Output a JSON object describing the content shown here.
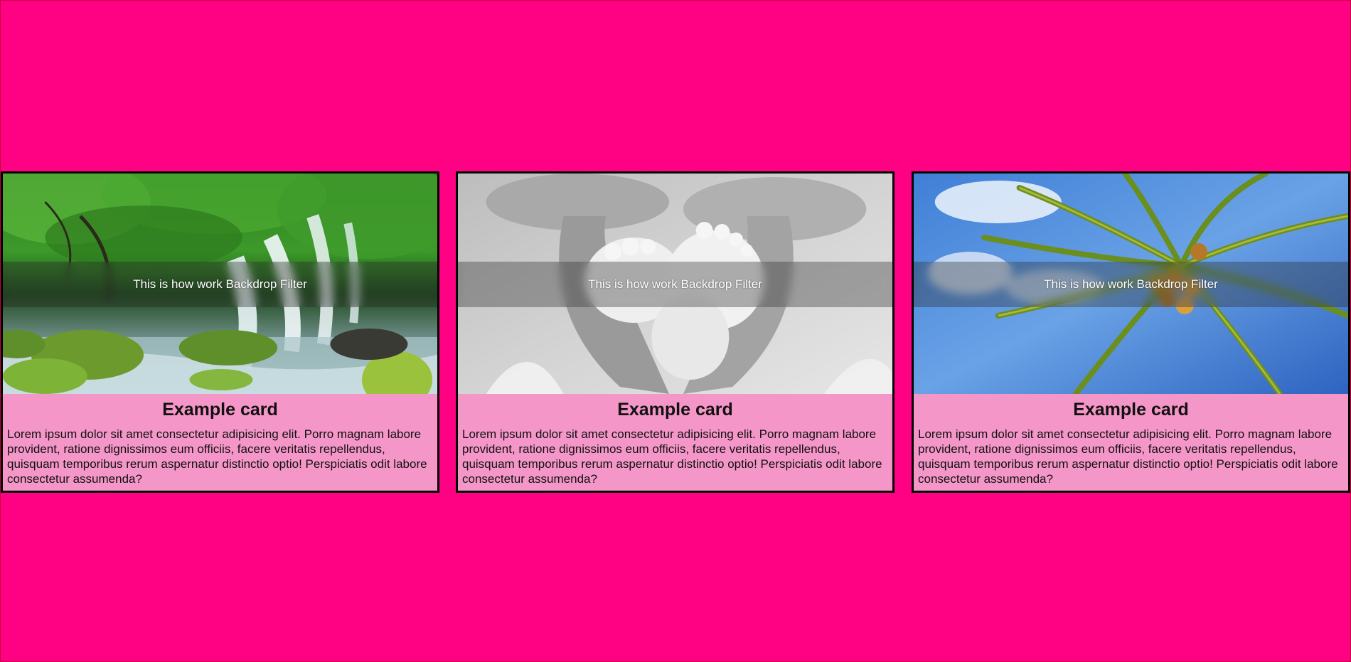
{
  "page": {
    "background": "#FF0284"
  },
  "cards": [
    {
      "image_label": "waterfall-forest-photo",
      "overlay_text": "This is how work Backdrop Filter",
      "title": "Example card",
      "body": "Lorem ipsum dolor sit amet consectetur adipisicing elit. Porro magnam labore provident, ratione dignissimos eum officiis, facere veritatis repellendus, quisquam temporibus rerum aspernatur distinctio optio! Perspiciatis odit labore consectetur assumenda?"
    },
    {
      "image_label": "baby-feet-heart-hands-photo",
      "overlay_text": "This is how work Backdrop Filter",
      "title": "Example card",
      "body": "Lorem ipsum dolor sit amet consectetur adipisicing elit. Porro magnam labore provident, ratione dignissimos eum officiis, facere veritatis repellendus, quisquam temporibus rerum aspernatur distinctio optio! Perspiciatis odit labore consectetur assumenda?"
    },
    {
      "image_label": "palm-tree-sky-photo",
      "overlay_text": "This is how work Backdrop Filter",
      "title": "Example card",
      "body": "Lorem ipsum dolor sit amet consectetur adipisicing elit. Porro magnam labore provident, ratione dignissimos eum officiis, facere veritatis repellendus, quisquam temporibus rerum aspernatur distinctio optio! Perspiciatis odit labore consectetur assumenda?"
    }
  ],
  "colors": {
    "card_body": "#F596C8",
    "card_border": "#000000",
    "overlay_text": "#FFFFFF"
  }
}
